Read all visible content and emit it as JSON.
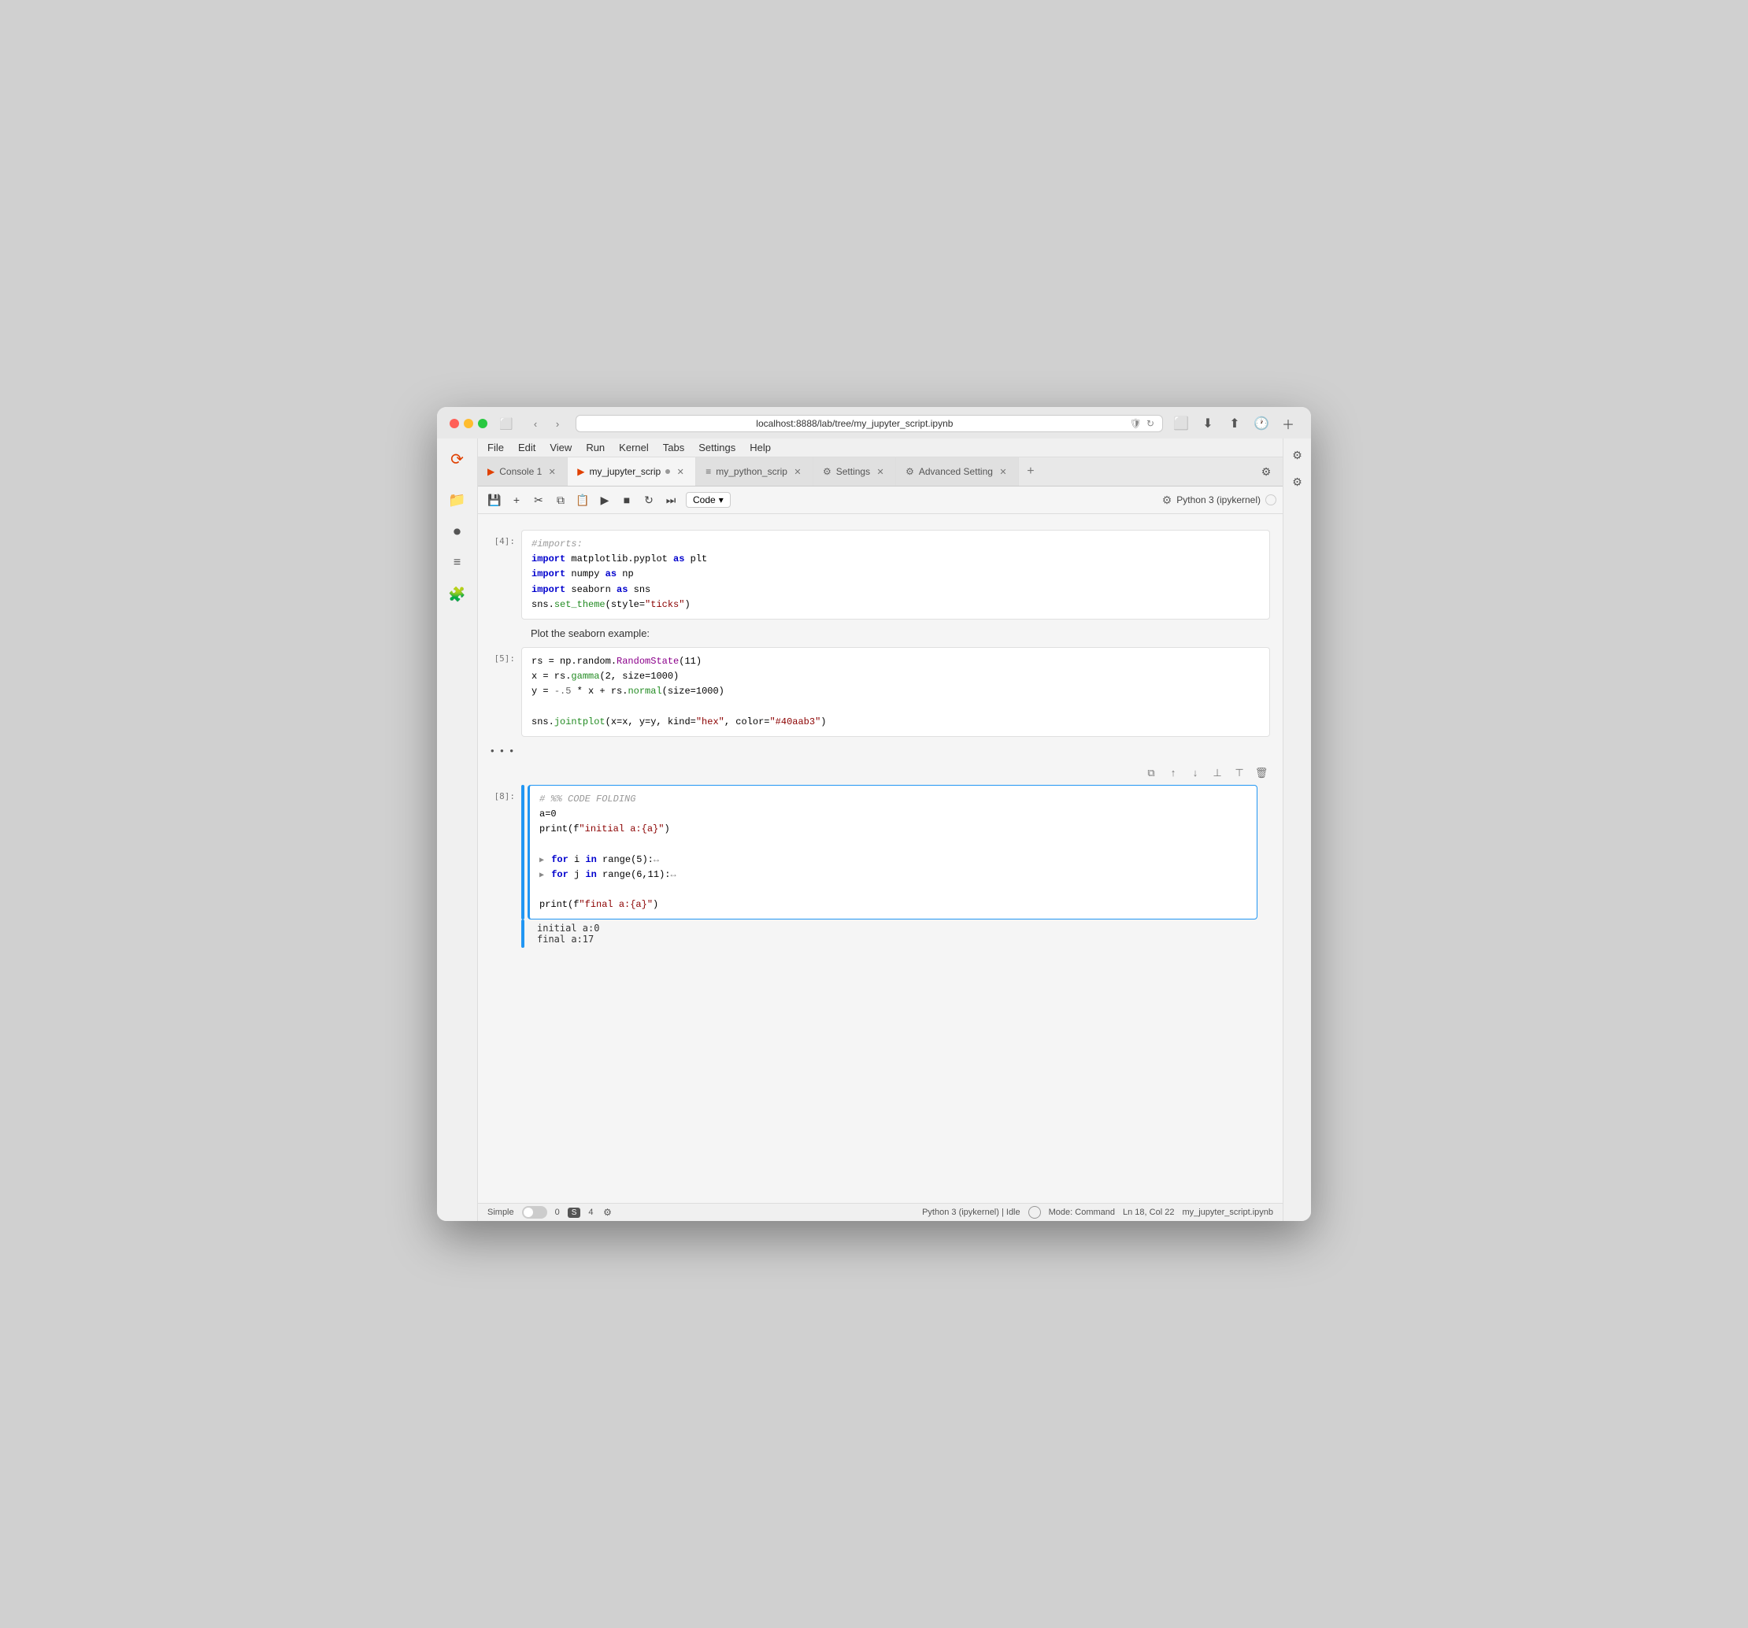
{
  "browser": {
    "address": "localhost:8888/lab/tree/my_jupyter_script.ipynb",
    "tabs": [
      {
        "id": "console",
        "icon": "▶",
        "label": "Console 1",
        "closable": true,
        "active": false,
        "type": "console"
      },
      {
        "id": "jupyter",
        "icon": "📄",
        "label": "my_jupyter_scrip",
        "closable": true,
        "active": true,
        "modified": true,
        "type": "jupyter"
      },
      {
        "id": "python",
        "icon": "≡",
        "label": "my_python_scrip",
        "closable": true,
        "active": false,
        "type": "text"
      },
      {
        "id": "settings",
        "icon": "⚙",
        "label": "Settings",
        "closable": true,
        "active": false,
        "type": "settings"
      },
      {
        "id": "advanced",
        "icon": "⚙",
        "label": "Advanced Setting",
        "closable": true,
        "active": false,
        "type": "advanced"
      }
    ]
  },
  "toolbar": {
    "cell_type": "Code",
    "kernel_name": "Python 3 (ipykernel)"
  },
  "cells": [
    {
      "id": "cell1",
      "type": "code",
      "number": "[4]:",
      "lines": [
        {
          "text": "#imports:",
          "class": "c-comment"
        },
        {
          "html": "<span class='c-keyword'>import</span> matplotlib.pyplot <span class='c-keyword'>as</span> plt"
        },
        {
          "html": "<span class='c-keyword'>import</span> numpy <span class='c-keyword'>as</span> np"
        },
        {
          "html": "<span class='c-keyword'>import</span> seaborn <span class='c-keyword'>as</span> sns"
        },
        {
          "html": "sns.<span class='c-method'>set_theme</span>(style=<span class='c-string'>\"ticks\"</span>)"
        }
      ]
    },
    {
      "id": "cell2",
      "type": "markdown",
      "text": "Plot the seaborn example:"
    },
    {
      "id": "cell3",
      "type": "code",
      "number": "[5]:",
      "lines": [
        {
          "html": "rs = np.random.<span class='c-function'>RandomState</span>(11)"
        },
        {
          "html": "x = rs.<span class='c-method'>gamma</span>(2, size=1000)"
        },
        {
          "html": "y = <span class='c-number'>-.5</span> * x + rs.<span class='c-method'>normal</span>(size=1000)"
        },
        {
          "html": ""
        },
        {
          "html": "sns.<span class='c-method'>jointplot</span>(x=x, y=y, kind=<span class='c-string'>\"hex\"</span>, color=<span class='c-string'>\"#40aab3\"</span>)"
        }
      ]
    },
    {
      "id": "ellipsis",
      "type": "ellipsis",
      "text": "• • •"
    },
    {
      "id": "cell4",
      "type": "code",
      "number": "[8]:",
      "active": true,
      "lines": [
        {
          "html": "<span class='c-comment'># %% CODE FOLDING</span>"
        },
        {
          "html": "a=0"
        },
        {
          "html": "print(f<span class='c-string'>\"initial a:{a}\"</span>)"
        },
        {
          "html": ""
        },
        {
          "html": "<span class='fold-arrow'>▶</span> <span class='c-keyword'>for</span> i <span class='c-keyword'>in</span> range(5):<span style='color:#888'>↔</span>"
        },
        {
          "html": "<span class='fold-arrow'>▶</span> <span class='c-keyword'>for</span> j <span class='c-keyword'>in</span> range(6,11):<span style='color:#888'>↔</span>"
        },
        {
          "html": ""
        },
        {
          "html": "print(f<span class='c-string'>\"final a:{a}\"</span>)"
        }
      ],
      "output": [
        "initial a:0",
        "final a:17"
      ]
    }
  ],
  "status_bar": {
    "mode_label": "Simple",
    "toggle_state": false,
    "number": "0",
    "badge": "S",
    "count": "4",
    "kernel": "Python 3 (ipykernel) | Idle",
    "mode": "Mode: Command",
    "position": "Ln 18, Col 22",
    "filename": "my_jupyter_script.ipynb"
  },
  "sidebar": {
    "icons": [
      "folder",
      "circle",
      "list",
      "puzzle"
    ]
  },
  "cell_actions": [
    "copy",
    "up",
    "down",
    "split",
    "merge",
    "delete"
  ]
}
